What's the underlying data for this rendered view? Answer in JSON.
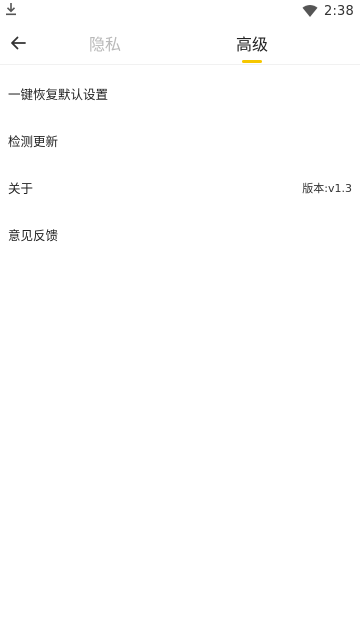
{
  "status_bar": {
    "time": "2:38",
    "left_icon": "download-icon",
    "right_icon": "wifi-icon"
  },
  "header": {
    "back_icon": "arrow-left-icon",
    "tabs": [
      {
        "label": "隐私",
        "active": false
      },
      {
        "label": "高级",
        "active": true
      }
    ],
    "indicator_color": "#f6c700"
  },
  "settings": {
    "items": [
      {
        "label": "一键恢复默认设置",
        "value": ""
      },
      {
        "label": "检测更新",
        "value": ""
      },
      {
        "label": "关于",
        "value": "版本:v1.3"
      },
      {
        "label": "意见反馈",
        "value": ""
      }
    ]
  }
}
